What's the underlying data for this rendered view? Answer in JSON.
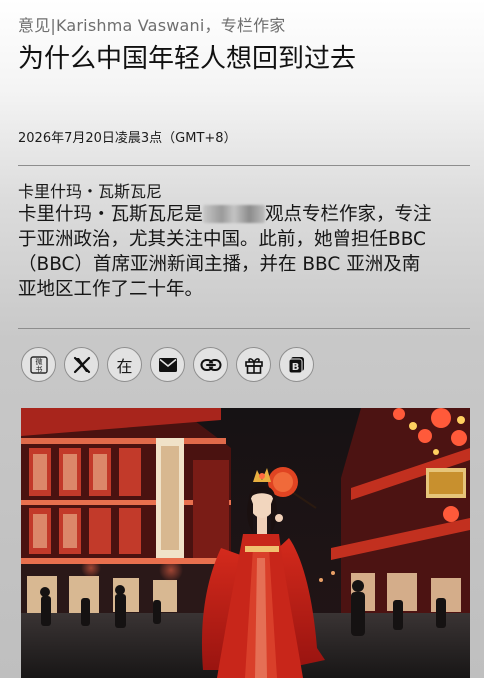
{
  "article": {
    "kicker": "意见|Karishma Vaswani，专栏作家",
    "headline": "为什么中国年轻人想回到过去",
    "dateline": "2026年7月20日凌晨3点（GMT+8）"
  },
  "author": {
    "name": "卡里什玛・瓦斯瓦尼",
    "bio_start": "卡里什玛・瓦斯瓦尼是",
    "bio_rest": "观点专栏作家，专注于亚洲政治，尤其关注中国。此前，她曾担任BBC（BBC）首席亚洲新闻主播，并在 BBC 亚洲及南亚地区工作了二十年。"
  },
  "share": {
    "buttons": [
      {
        "id": "weibo",
        "icon": "weibo-icon"
      },
      {
        "id": "x",
        "icon": "x-logo-icon"
      },
      {
        "id": "in",
        "icon": "linkedin-icon",
        "label": "在"
      },
      {
        "id": "email",
        "icon": "envelope-icon"
      },
      {
        "id": "link",
        "icon": "link-icon"
      },
      {
        "id": "gift",
        "icon": "gift-icon"
      },
      {
        "id": "bloomberg",
        "icon": "bloomberg-b-icon"
      }
    ],
    "weibo_glyph": "微\n书"
  },
  "photo": {
    "subject": "hero-photo-woman-in-red-hanfu-at-night-street"
  },
  "colors": {
    "lantern_red": "#c4201a",
    "night_sky": "#121212"
  }
}
